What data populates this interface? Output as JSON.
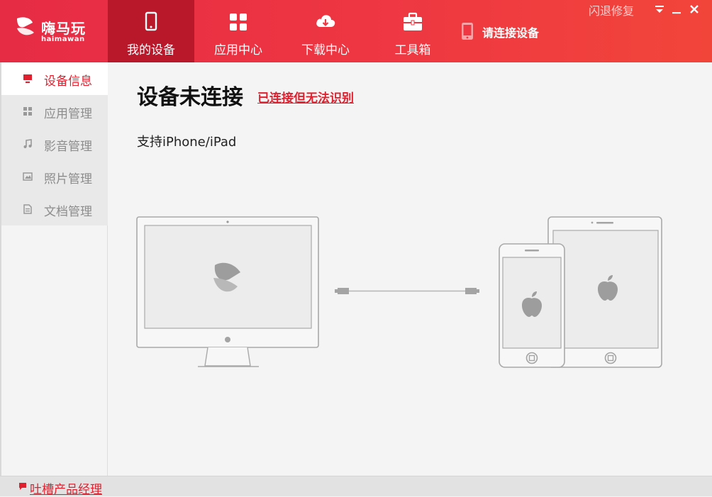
{
  "app": {
    "logo_text": "嗨马玩",
    "logo_sub": "haimawan"
  },
  "nav": {
    "tabs": [
      {
        "label": "我的设备",
        "icon": "phone-icon",
        "active": true
      },
      {
        "label": "应用中心",
        "icon": "apps-grid-icon",
        "active": false
      },
      {
        "label": "下载中心",
        "icon": "cloud-download-icon",
        "active": false
      },
      {
        "label": "工具箱",
        "icon": "toolbox-icon",
        "active": false
      }
    ],
    "connect_status": "请连接设备"
  },
  "titlebar": {
    "crash_repair": "闪退修复",
    "controls": [
      "menu-icon",
      "minimize-icon",
      "close-icon"
    ]
  },
  "sidebar": {
    "items": [
      {
        "label": "设备信息",
        "icon": "monitor-icon",
        "active": true
      },
      {
        "label": "应用管理",
        "icon": "apps-icon",
        "active": false
      },
      {
        "label": "影音管理",
        "icon": "music-note-icon",
        "active": false
      },
      {
        "label": "照片管理",
        "icon": "photo-icon",
        "active": false
      },
      {
        "label": "文档管理",
        "icon": "document-icon",
        "active": false
      }
    ]
  },
  "main": {
    "title": "设备未连接",
    "title_link": "已连接但无法识别",
    "support_text": "支持iPhone/iPad"
  },
  "footer": {
    "feedback": "吐槽产品经理"
  },
  "colors": {
    "brand_red": "#e62b45",
    "active_tab": "#b9182b",
    "link_red": "#e0202e"
  }
}
